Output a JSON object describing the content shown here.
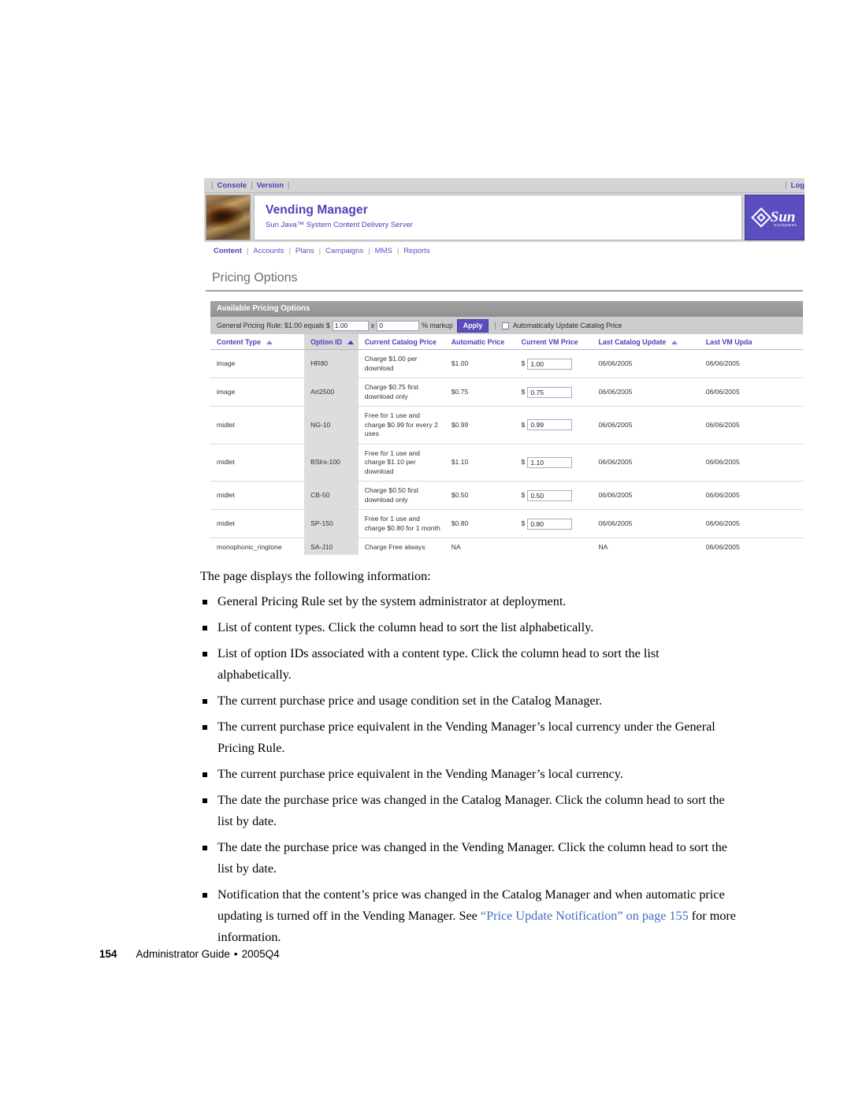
{
  "screenshot": {
    "utility_bar": {
      "left_links": [
        "Console",
        "Version"
      ],
      "right_link": "Log"
    },
    "masthead": {
      "title": "Vending Manager",
      "subtitle": "Sun Java™ System Content Delivery Server",
      "logo_word": "Sun",
      "logo_tagline": "microsystems"
    },
    "nav": {
      "items": [
        "Content",
        "Accounts",
        "Plans",
        "Campaigns",
        "MMS",
        "Reports"
      ],
      "active": "Content"
    },
    "page_title": "Pricing Options",
    "panel": {
      "header": "Available Pricing Options",
      "rule": {
        "prefix": "General Pricing Rule: $1.00 equals $",
        "equals_value": "1.00",
        "multiply_symbol": "x",
        "markup_value": "0",
        "markup_suffix": "% markup",
        "apply_label": "Apply",
        "auto_update_label": "Automatically Update Catalog Price",
        "auto_update_checked": false
      },
      "table": {
        "columns": [
          {
            "label": "Content Type",
            "sort": "asc-outline",
            "sorted": false
          },
          {
            "label": "Option ID",
            "sort": "asc-filled",
            "sorted": true
          },
          {
            "label": "Current Catalog Price",
            "sort": "none",
            "sorted": false
          },
          {
            "label": "Automatic Price",
            "sort": "none",
            "sorted": false
          },
          {
            "label": "Current VM Price",
            "sort": "none",
            "sorted": false
          },
          {
            "label": "Last Catalog Update",
            "sort": "asc-outline",
            "sorted": false
          },
          {
            "label": "Last VM Upda",
            "sort": "none",
            "sorted": false
          }
        ],
        "rows": [
          {
            "content_type": "image",
            "option_id": "HR80",
            "current_catalog_price": "Charge $1.00 per download",
            "automatic_price": "$1.00",
            "vm_currency": "$",
            "current_vm_price": "1.00",
            "last_catalog_update": "06/06/2005",
            "last_vm_update": "06/06/2005"
          },
          {
            "content_type": "image",
            "option_id": "Art2500",
            "current_catalog_price": "Charge $0.75 first download only",
            "automatic_price": "$0.75",
            "vm_currency": "$",
            "current_vm_price": "0.75",
            "last_catalog_update": "06/06/2005",
            "last_vm_update": "06/06/2005"
          },
          {
            "content_type": "midlet",
            "option_id": "NG-10",
            "current_catalog_price": "Free for 1 use and charge $0.99 for every 2 uses",
            "automatic_price": "$0.99",
            "vm_currency": "$",
            "current_vm_price": "0.99",
            "last_catalog_update": "06/06/2005",
            "last_vm_update": "06/06/2005"
          },
          {
            "content_type": "midlet",
            "option_id": "BSlrs-100",
            "current_catalog_price": "Free for 1 use and charge $1.10 per download",
            "automatic_price": "$1.10",
            "vm_currency": "$",
            "current_vm_price": "1.10",
            "last_catalog_update": "06/06/2005",
            "last_vm_update": "06/06/2005"
          },
          {
            "content_type": "midlet",
            "option_id": "CB-50",
            "current_catalog_price": "Charge $0.50 first download only",
            "automatic_price": "$0.50",
            "vm_currency": "$",
            "current_vm_price": "0.50",
            "last_catalog_update": "06/06/2005",
            "last_vm_update": "06/06/2005"
          },
          {
            "content_type": "midlet",
            "option_id": "SP-150",
            "current_catalog_price": "Free for 1 use and charge $0.80 for 1 month",
            "automatic_price": "$0.80",
            "vm_currency": "$",
            "current_vm_price": "0.80",
            "last_catalog_update": "06/06/2005",
            "last_vm_update": "06/06/2005"
          },
          {
            "content_type": "monophonic_ringtone",
            "option_id": "SA-J10",
            "current_catalog_price": "Charge Free always",
            "automatic_price": "NA",
            "vm_currency": "",
            "current_vm_price": "",
            "last_catalog_update": "NA",
            "last_vm_update": "06/06/2005"
          }
        ]
      }
    }
  },
  "body": {
    "intro": "The page displays the following information:",
    "bullets": [
      "General Pricing Rule set by the system administrator at deployment.",
      "List of content types. Click the column head to sort the list alphabetically.",
      "List of option IDs associated with a content type. Click the column head to sort the list alphabetically.",
      "The current purchase price and usage condition set in the Catalog Manager.",
      "The current purchase price equivalent in the Vending Manager’s local currency under the General Pricing Rule.",
      "The current purchase price equivalent in the Vending Manager’s local currency.",
      "The date the purchase price was changed in the Catalog Manager. Click the column head to sort the list by date.",
      "The date the purchase price was changed in the Vending Manager. Click the column head to sort the list by date."
    ],
    "last_bullet": {
      "before": "Notification that the content’s price was changed in the Catalog Manager and when automatic price updating is turned off in the Vending Manager. See ",
      "link": "“Price Update Notification” on page 155",
      "after": " for more information."
    }
  },
  "footer": {
    "page_number": "154",
    "guide": "Administrator Guide",
    "separator": "•",
    "release": "2005Q4"
  },
  "colors": {
    "accent": "#4c3fbb",
    "button": "#5b4fc0",
    "panel_header": "#9a9a9a",
    "rule_bar": "#cccccc",
    "link": "#3e6ec2"
  }
}
